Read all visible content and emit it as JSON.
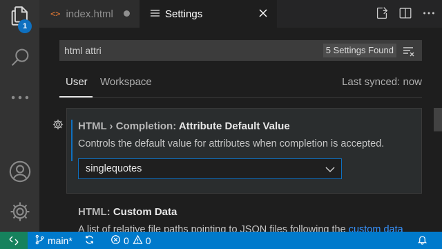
{
  "activity_bar": {
    "explorer_badge": "1",
    "icons": [
      "files-icon",
      "search-icon",
      "more-icon",
      "account-icon",
      "manage-gear-icon"
    ]
  },
  "tabs": [
    {
      "label": "index.html",
      "icon": "html-code-icon",
      "state": "modified"
    },
    {
      "label": "Settings",
      "icon": "settings-list-icon",
      "state": "active"
    }
  ],
  "editor_actions": [
    "open-settings-json-icon",
    "split-editor-icon",
    "more-actions-icon"
  ],
  "settings": {
    "search": {
      "value": "html attri",
      "results_badge": "5 Settings Found"
    },
    "scope_tabs": {
      "user": "User",
      "workspace": "Workspace",
      "last_synced": "Last synced: now"
    },
    "items": [
      {
        "category": "HTML › Completion: ",
        "key": "Attribute Default Value",
        "description": "Controls the default value for attributes when completion is accepted.",
        "selected_value": "singlequotes"
      },
      {
        "category": "HTML: ",
        "key": "Custom Data",
        "description": "A list of relative file paths pointing to JSON files following the ",
        "link": "custom data"
      }
    ]
  },
  "statusbar": {
    "branch": "main*",
    "errors": "0",
    "warnings": "0"
  },
  "colors": {
    "accent": "#007acc",
    "remote": "#16825d",
    "focus_border": "#0e70c0",
    "link": "#3794ff"
  }
}
